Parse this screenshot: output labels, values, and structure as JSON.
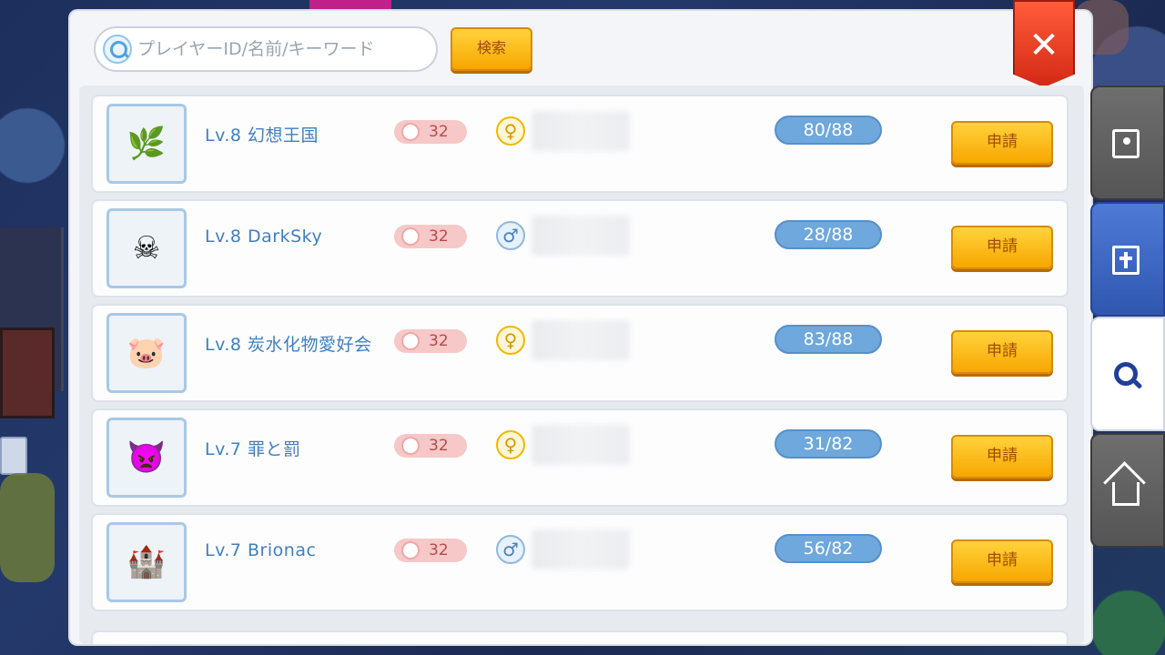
{
  "search": {
    "placeholder": "プレイヤーID/名前/キーワード",
    "button_label": "検索"
  },
  "close_label": "✕",
  "guilds": [
    {
      "name": "Lv.8  幻想王国",
      "level": "32",
      "gender": "♀",
      "members": "80/88",
      "apply": "申請",
      "emblem": "🌿"
    },
    {
      "name": "Lv.8  DarkSky",
      "level": "32",
      "gender": "♂",
      "members": "28/88",
      "apply": "申請",
      "emblem": "☠"
    },
    {
      "name": "Lv.8  炭水化物愛好会",
      "level": "32",
      "gender": "♀",
      "members": "83/88",
      "apply": "申請",
      "emblem": "🐷"
    },
    {
      "name": "Lv.7  罪と罰",
      "level": "32",
      "gender": "♀",
      "members": "31/82",
      "apply": "申請",
      "emblem": "👿"
    },
    {
      "name": "Lv.7  Brionac",
      "level": "32",
      "gender": "♂",
      "members": "56/82",
      "apply": "申請",
      "emblem": "🏰"
    }
  ],
  "side_tabs": [
    {
      "icon": "contacts-icon",
      "state": "inactive"
    },
    {
      "icon": "guild-icon",
      "state": "inactive-blue"
    },
    {
      "icon": "search-icon",
      "state": "active"
    },
    {
      "icon": "guild-house-icon",
      "state": "inactive"
    }
  ],
  "colors": {
    "accent_orange": "#f7a700",
    "member_pill": "#6ea8dc",
    "name_blue": "#3f7fc0",
    "close_red": "#d42a16"
  }
}
